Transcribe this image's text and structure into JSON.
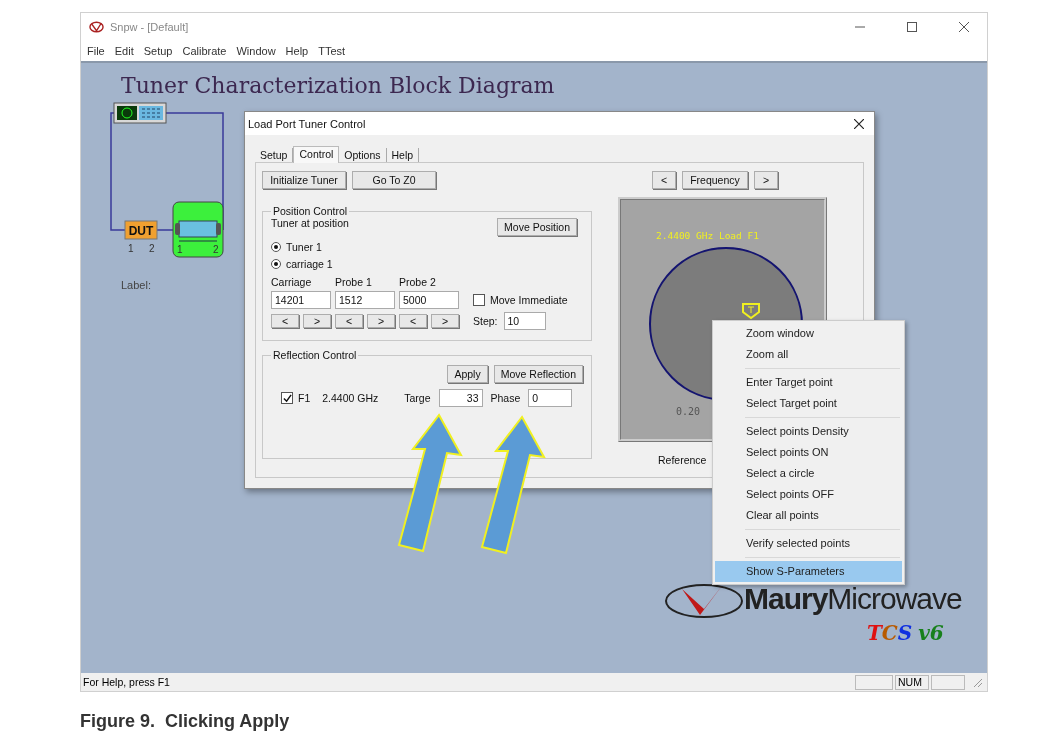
{
  "window": {
    "title": "Snpw - [Default]"
  },
  "menu_bar": [
    "File",
    "Edit",
    "Setup",
    "Calibrate",
    "Window",
    "Help",
    "TTest"
  ],
  "diagram": {
    "title": "Tuner Characterization Block Diagram",
    "dut_label": "DUT",
    "dut_ports": [
      "1",
      "2"
    ],
    "tuner_ports": [
      "1",
      "2"
    ],
    "label": "Label:"
  },
  "dialog": {
    "title": "Load Port Tuner Control",
    "tabs": [
      {
        "label": "Setup",
        "selected": false
      },
      {
        "label": "Control",
        "selected": true
      },
      {
        "label": "Options",
        "selected": false
      },
      {
        "label": "Help",
        "selected": false
      }
    ],
    "buttons": [
      "Initialize Tuner",
      "Go To Z0"
    ],
    "position_control": {
      "title": "Position Control",
      "status": "Tuner at position",
      "move_button": "Move Position",
      "radios": [
        {
          "label": "Tuner 1",
          "checked": true
        },
        {
          "label": "carriage 1",
          "checked": true
        }
      ],
      "fields": [
        {
          "label": "Carriage",
          "value": "14201",
          "dec": "<",
          "inc": ">"
        },
        {
          "label": "Probe 1",
          "value": "1512",
          "dec": "<",
          "inc": ">"
        },
        {
          "label": "Probe 2",
          "value": "5000",
          "dec": "<",
          "inc": ">"
        }
      ],
      "move_immediate": {
        "label": "Move Immediate",
        "checked": false
      },
      "step": {
        "label": "Step:",
        "value": "10"
      }
    },
    "reflection_control": {
      "title": "Reflection Control",
      "apply_button": "Apply",
      "move_button": "Move Reflection",
      "checked": true,
      "frequency_name": "F1",
      "frequency": "2.4400 GHz",
      "target_label": "Targe",
      "target_value": "33",
      "phase_label": "Phase",
      "phase_value": "0"
    },
    "chart_nav": {
      "prev": "<",
      "label": "Frequency",
      "next": ">"
    },
    "smith_chart": {
      "title": "2.4400 GHz Load F1",
      "reading": "0.20"
    },
    "reference": "Reference"
  },
  "context_menu": [
    [
      {
        "label": "Zoom window",
        "selected": false
      },
      {
        "label": "Zoom all",
        "selected": false
      }
    ],
    [
      {
        "label": "Enter Target point",
        "selected": false
      },
      {
        "label": "Select Target point",
        "selected": false
      }
    ],
    [
      {
        "label": "Select points Density",
        "selected": false
      },
      {
        "label": "Select points ON",
        "selected": false
      },
      {
        "label": "Select a circle",
        "selected": false
      },
      {
        "label": "Select points OFF",
        "selected": false
      },
      {
        "label": "Clear all points",
        "selected": false
      }
    ],
    [
      {
        "label": "Verify selected points",
        "selected": false
      }
    ],
    [
      {
        "label": "Show S-Parameters",
        "selected": true
      }
    ]
  ],
  "logo": {
    "brand": "**Maury**Microwave",
    "product": "TCS",
    "version": "v6"
  },
  "status_bar": {
    "text": "For Help, press F1",
    "indicators": [
      "NUM"
    ]
  },
  "caption": "Figure 9.  Clicking Apply"
}
